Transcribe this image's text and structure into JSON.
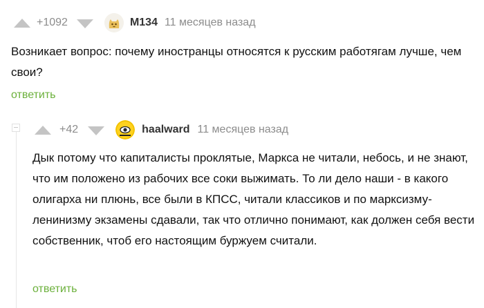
{
  "comments": [
    {
      "score": "+1092",
      "author": "M134",
      "time": "11 месяцев назад",
      "text": "Возникает вопрос: почему иностранцы относятся к русским работягам лучше, чем свои?",
      "reply_label": "ответить",
      "avatar_icon": "cat-avatar-icon"
    },
    {
      "score": "+42",
      "author": "haalward",
      "time": "11 месяцев назад",
      "text": "Дык потому что капиталисты проклятые, Маркса не читали, небось, и не знают, что им положено из рабочих все соки выжимать. То ли дело наши - в какого олигарха ни плюнь, все были в КПСС, читали классиков и по марксизму-ленинизму экзамены сдавали, так что отлично понимают, как должен себя вести собственник, чтоб его настоящим буржуем считали.",
      "reply_label": "ответить",
      "avatar_icon": "eye-badge-avatar-icon"
    }
  ],
  "colors": {
    "accent": "#6bb03b",
    "muted": "#8c8c8c",
    "arrow": "#c4c4c4",
    "author": "#333333"
  }
}
